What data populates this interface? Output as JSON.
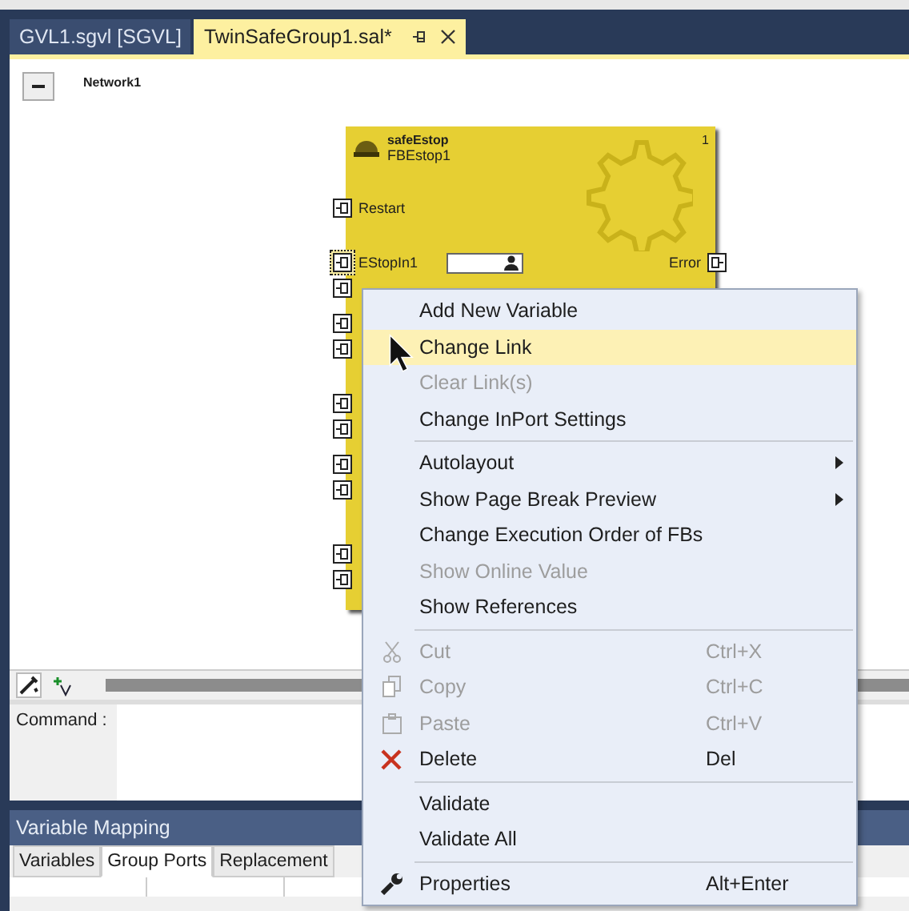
{
  "document_tabs": [
    {
      "label": "GVL1.sgvl [SGVL]",
      "selected": false,
      "modified_pin": false
    },
    {
      "label": "TwinSafeGroup1.sal*",
      "selected": true,
      "modified_pin": true
    }
  ],
  "network": {
    "label": "Network1",
    "expanded": true
  },
  "block": {
    "type_name": "safeEstop",
    "instance_name": "FBEstop1",
    "number": "1",
    "inputs": [
      {
        "label": "Restart",
        "selected": false
      },
      {
        "label": "EStopIn1",
        "selected": true
      },
      {
        "selected": false
      },
      {
        "selected": false
      },
      {
        "selected": false
      },
      {
        "selected": false
      },
      {
        "selected": false
      },
      {
        "selected": false
      },
      {
        "selected": false
      },
      {
        "selected": false
      },
      {
        "selected": false
      }
    ],
    "outputs": [
      {
        "label": "Error"
      }
    ]
  },
  "command": {
    "label": "Command :"
  },
  "variable_mapping": {
    "title": "Variable Mapping",
    "tabs": [
      {
        "label": "Variables",
        "selected": false
      },
      {
        "label": "Group Ports",
        "selected": true
      },
      {
        "label": "Replacement",
        "selected": false
      }
    ]
  },
  "context_menu": [
    [
      {
        "label": "Add New Variable",
        "disabled": false,
        "selected": false
      },
      {
        "label": "Change Link",
        "disabled": false,
        "selected": true
      },
      {
        "label": "Clear Link(s)",
        "disabled": true,
        "selected": false
      },
      {
        "label": "Change InPort Settings",
        "disabled": false,
        "selected": false
      }
    ],
    [
      {
        "label": "Autolayout",
        "disabled": false,
        "selected": false,
        "submenu": true
      },
      {
        "label": "Show Page Break Preview",
        "disabled": false,
        "selected": false,
        "submenu": true
      },
      {
        "label": "Change Execution Order of FBs",
        "disabled": false,
        "selected": false
      },
      {
        "label": "Show Online Value",
        "disabled": true,
        "selected": false
      },
      {
        "label": "Show References",
        "disabled": false,
        "selected": false
      }
    ],
    [
      {
        "kind": "cut",
        "label": "Cut",
        "shortcut": "Ctrl+X",
        "disabled": true,
        "selected": false
      },
      {
        "kind": "copy",
        "label": "Copy",
        "shortcut": "Ctrl+C",
        "disabled": true,
        "selected": false
      },
      {
        "kind": "paste",
        "label": "Paste",
        "shortcut": "Ctrl+V",
        "disabled": true,
        "selected": false
      },
      {
        "kind": "delete",
        "label": "Delete",
        "shortcut": "Del",
        "disabled": false,
        "selected": false
      }
    ],
    [
      {
        "label": "Validate",
        "disabled": false,
        "selected": false
      },
      {
        "label": "Validate All",
        "disabled": false,
        "selected": false
      }
    ],
    [
      {
        "kind": "properties",
        "label": "Properties",
        "shortcut": "Alt+Enter",
        "disabled": false,
        "selected": false
      }
    ]
  ]
}
